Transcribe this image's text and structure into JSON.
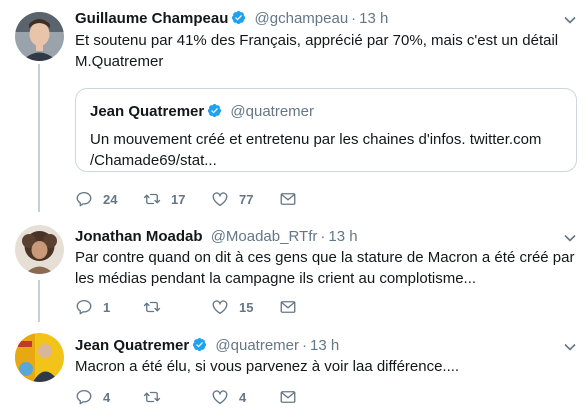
{
  "tweets": [
    {
      "name": "Guillaume Champeau",
      "handle": "@gchampeau",
      "dot": "·",
      "time": "13 h",
      "text": "Et soutenu par 41% des Français, apprécié par 70%, mais c'est un détail M.Quatremer",
      "quote": {
        "name": "Jean Quatremer",
        "handle": "@quatremer",
        "text": "Un mouvement créé et entretenu par les chaines d'infos. twitter.com /Chamade69/stat..."
      },
      "replies": "24",
      "retweets": "17",
      "likes": "77"
    },
    {
      "name": "Jonathan Moadab",
      "handle": "@Moadab_RTfr",
      "dot": "·",
      "time": "13 h",
      "text": "Par contre quand on dit à ces gens que la stature de Macron a été créé par les médias pendant la campagne ils crient au complotisme...",
      "replies": "1",
      "retweets": "",
      "likes": "15"
    },
    {
      "name": "Jean Quatremer",
      "handle": "@quatremer",
      "dot": "·",
      "time": "13 h",
      "text": "Macron a été élu, si vous parvenez à voir laa différence....",
      "replies": "4",
      "retweets": "",
      "likes": "4"
    }
  ],
  "icons": {
    "verified": "verified-badge-icon",
    "reply": "reply-icon",
    "retweet": "retweet-icon",
    "like": "heart-icon",
    "dm": "envelope-icon",
    "more": "chevron-down-icon"
  },
  "colors": {
    "verified": "#1da1f2",
    "muted": "#657786",
    "thread": "#c4cfd6",
    "border": "#ccd6dd"
  }
}
